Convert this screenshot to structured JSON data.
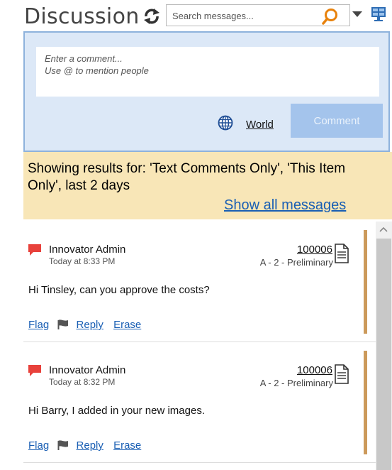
{
  "header": {
    "title": "Discussion",
    "search_placeholder": "Search messages..."
  },
  "compose": {
    "placeholder_line1": "Enter a comment...",
    "placeholder_line2": "Use @ to mention people",
    "visibility_label": "World",
    "comment_button": "Comment"
  },
  "filter": {
    "results_text": "Showing results for: 'Text Comments Only', 'This Item Only', last 2 days",
    "show_all_label": "Show all messages"
  },
  "messages": [
    {
      "author": "Innovator Admin",
      "time": "Today at 8:33 PM",
      "item_number": "100006",
      "item_revision": "A - 2 - Preliminary",
      "text": "Hi Tinsley, can you approve the costs?",
      "flag_label": "Flag",
      "reply_label": "Reply",
      "erase_label": "Erase"
    },
    {
      "author": "Innovator Admin",
      "time": "Today at 8:32 PM",
      "item_number": "100006",
      "item_revision": "A - 2 - Preliminary",
      "text": "Hi Barry, I added in your new images.",
      "flag_label": "Flag",
      "reply_label": "Reply",
      "erase_label": "Erase"
    }
  ],
  "icons": {
    "refresh": "refresh-icon",
    "search": "search-icon",
    "dropdown": "chevron-down-icon",
    "view": "display-icon",
    "world": "globe-icon",
    "message_flag": "comment-flag-icon",
    "document": "document-icon",
    "flag": "flag-icon"
  },
  "colors": {
    "compose_bg": "#dce8f7",
    "compose_border": "#8eb2dc",
    "comment_button": "#a4c4ec",
    "results_bg": "#f8e6b7",
    "link": "#1a5fb4",
    "accent": "#cc9a5b",
    "message_flag": "#e8413b",
    "search_icon": "#e8820c"
  }
}
